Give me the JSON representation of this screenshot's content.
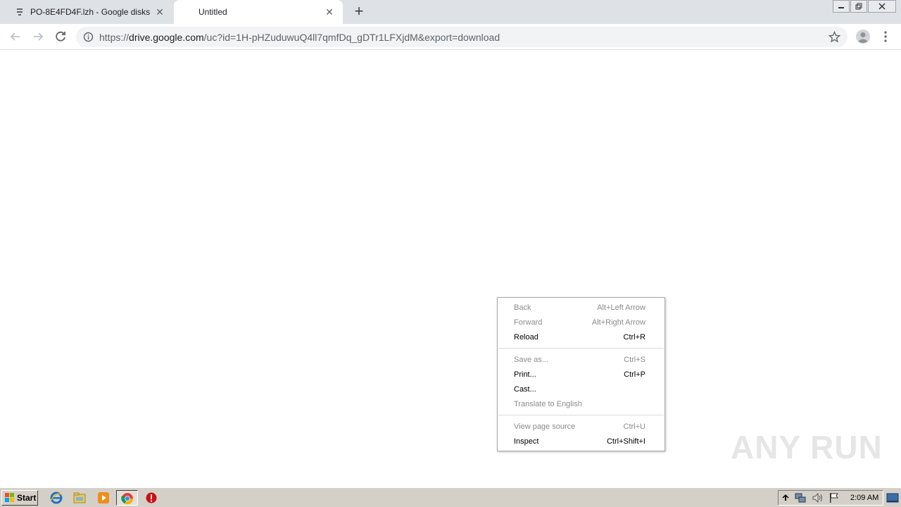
{
  "tabs": [
    {
      "title": "PO-8E4FD4F.lzh - Google disks",
      "close": "✕",
      "active": false
    },
    {
      "title": "Untitled",
      "close": "✕",
      "active": true
    }
  ],
  "new_tab": "+",
  "omnibox": {
    "scheme": "https://",
    "host": "drive.google.com",
    "path": "/uc?id=1H-pHZuduwuQ4ll7qmfDq_gDTr1LFXjdM&export=download"
  },
  "context_menu": {
    "items": [
      {
        "label": "Back",
        "shortcut": "Alt+Left Arrow",
        "enabled": false
      },
      {
        "label": "Forward",
        "shortcut": "Alt+Right Arrow",
        "enabled": false
      },
      {
        "label": "Reload",
        "shortcut": "Ctrl+R",
        "enabled": true
      },
      {
        "label": "Save as...",
        "shortcut": "Ctrl+S",
        "enabled": false
      },
      {
        "label": "Print...",
        "shortcut": "Ctrl+P",
        "enabled": true
      },
      {
        "label": "Cast...",
        "shortcut": "",
        "enabled": true
      },
      {
        "label": "Translate to English",
        "shortcut": "",
        "enabled": false
      },
      {
        "label": "View page source",
        "shortcut": "Ctrl+U",
        "enabled": false
      },
      {
        "label": "Inspect",
        "shortcut": "Ctrl+Shift+I",
        "enabled": true
      }
    ]
  },
  "watermark": "ANY RUN",
  "taskbar": {
    "start_label": "Start",
    "clock": "2:09 AM"
  },
  "colors": {
    "tabstrip": "#dee1e6",
    "omnibox": "#f1f3f4",
    "taskbar": "#d4d0c8",
    "menu_disabled": "#8b8b8b"
  }
}
